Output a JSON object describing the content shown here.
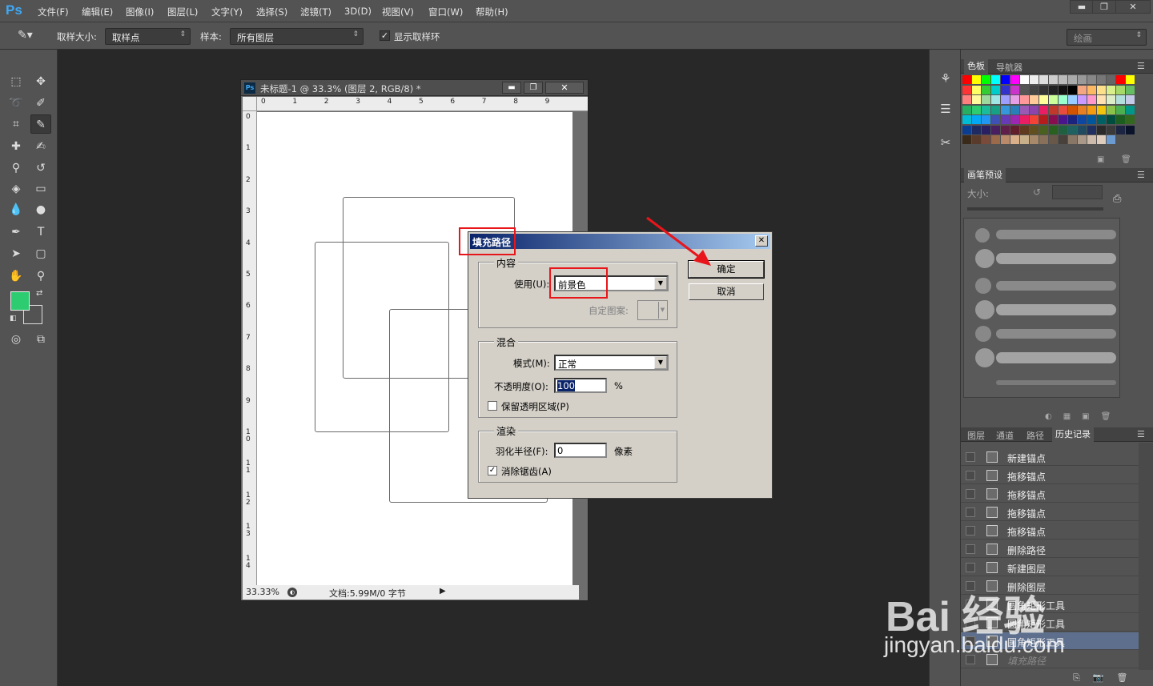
{
  "app": {
    "logo": "Ps",
    "menu": [
      "文件(F)",
      "编辑(E)",
      "图像(I)",
      "图层(L)",
      "文字(Y)",
      "选择(S)",
      "滤镜(T)",
      "3D(D)",
      "视图(V)",
      "窗口(W)",
      "帮助(H)"
    ]
  },
  "window_controls": {
    "minimize": "▬",
    "restore": "❐",
    "close": "✕"
  },
  "options": {
    "sample_size_label": "取样大小:",
    "sample_size_value": "取样点",
    "sample_label": "样本:",
    "sample_value": "所有图层",
    "show_ring_label": "显示取样环",
    "show_ring_checked": true,
    "workspace_value": "绘画"
  },
  "document": {
    "title": "未标题-1 @ 33.3% (图层 2, RGB/8) *",
    "ruler_h": [
      "0",
      "1",
      "2",
      "3",
      "4",
      "5",
      "6",
      "7",
      "8",
      "9"
    ],
    "ruler_v": [
      "0",
      "1",
      "2",
      "3",
      "4",
      "5",
      "6",
      "7",
      "8",
      "9",
      "1\n0",
      "1\n1",
      "1\n2",
      "1\n3",
      "1\n4"
    ],
    "zoom": "33.33%",
    "doc_info": "文档:5.99M/0 字节"
  },
  "dialog": {
    "title": "填充路径",
    "content_group": "内容",
    "use_label": "使用(U):",
    "use_value": "前景色",
    "pattern_label": "自定图案:",
    "blend_group": "混合",
    "mode_label": "模式(M):",
    "mode_value": "正常",
    "opacity_label": "不透明度(O):",
    "opacity_value": "100",
    "opacity_unit": "%",
    "preserve_label": "保留透明区域(P)",
    "preserve_checked": false,
    "render_group": "渲染",
    "feather_label": "羽化半径(F):",
    "feather_value": "0",
    "feather_unit": "像素",
    "antialias_label": "消除锯齿(A)",
    "antialias_checked": true,
    "ok": "确定",
    "cancel": "取消",
    "close": "✕"
  },
  "panels": {
    "swatches_tabs": [
      "色板",
      "导航器"
    ],
    "brush_tab": "画笔预设",
    "brush_size_label": "大小:",
    "layers_tabs": [
      "图层",
      "通道",
      "路径",
      "历史记录"
    ],
    "history": [
      "新建锚点",
      "拖移锚点",
      "拖移锚点",
      "拖移锚点",
      "拖移锚点",
      "删除路径",
      "新建图层",
      "删除图层",
      "圆角矩形工具",
      "圆角矩形工具",
      "圆角矩形工具",
      "填充路径"
    ]
  },
  "watermark": {
    "text": "Bai 经验",
    "url": "jingyan.baidu.com"
  },
  "colors": {
    "foreground": "#2ecc71",
    "background": "#535353",
    "accent": "#e8161b"
  }
}
